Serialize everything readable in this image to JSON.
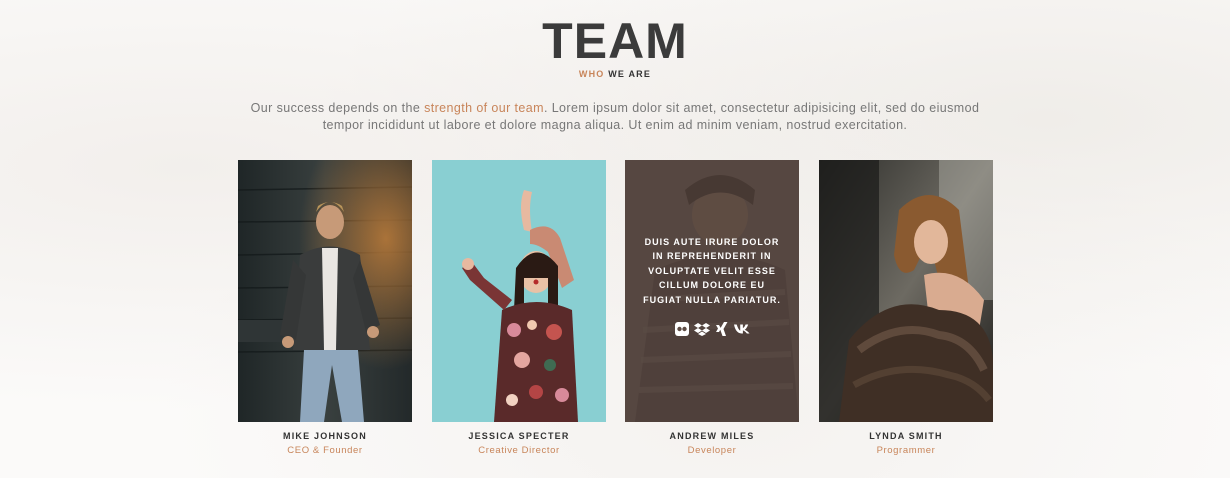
{
  "header": {
    "title": "TEAM",
    "subtitle_accent": "WHO",
    "subtitle_rest": "WE ARE"
  },
  "intro": {
    "before": "Our success depends on the ",
    "highlight": "strength of our team",
    "after": ". Lorem ipsum dolor sit amet, consectetur adipisicing elit, sed do eiusmod tempor incididunt ut labore et dolore magna aliqua. Ut enim ad minim veniam, nostrud exercitation."
  },
  "members": [
    {
      "name": "MIKE JOHNSON",
      "role": "CEO & Founder"
    },
    {
      "name": "JESSICA SPECTER",
      "role": "Creative Director"
    },
    {
      "name": "ANDREW MILES",
      "role": "Developer"
    },
    {
      "name": "LYNDA SMITH",
      "role": "Programmer"
    }
  ],
  "hover_card": {
    "text": "DUIS AUTE IRURE DOLOR IN REPREHENDERIT IN VOLUPTATE VELIT ESSE CILLUM DOLORE EU FUGIAT NULLA PARIATUR.",
    "social_icons": [
      "flickr-icon",
      "dropbox-icon",
      "xing-icon",
      "vk-icon"
    ]
  },
  "colors": {
    "accent": "#c8855a",
    "heading": "#3b3b3b",
    "body_text": "#777777"
  }
}
